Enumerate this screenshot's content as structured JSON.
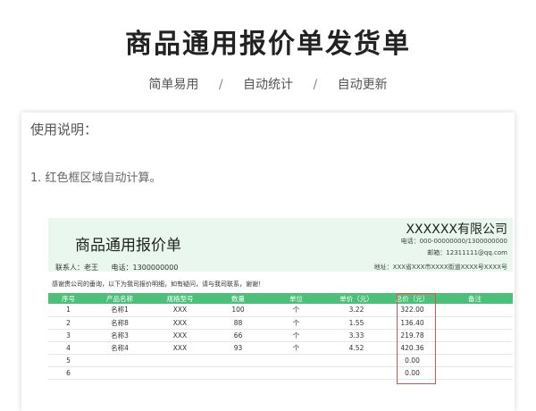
{
  "header": {
    "title": "商品通用报价单发货单",
    "features": [
      "简单易用",
      "自动统计",
      "自动更新"
    ],
    "separator": "/"
  },
  "usage": {
    "title": "使用说明：",
    "item1": "1. 红色框区域自动计算。"
  },
  "sheet": {
    "title": "商品通用报价单",
    "company": "XXXXXX有限公司",
    "phone": "电话：000-00000000/1300000000",
    "email": "邮箱：12311111@qq.com",
    "contact": "联系人：老王",
    "contact_phone": "电话：1300000000",
    "address": "地址：XXX省XXX市XXXX街道XXXX号XXXX号",
    "thanks": "感谢贵公司的垂询，以下为我司报价明细，如有疑问，请与我司联系，谢谢！",
    "columns": [
      "序号",
      "产品名称",
      "规格型号",
      "数量",
      "单位",
      "单价（元）",
      "总价（元）",
      "备注"
    ],
    "rows": [
      [
        "1",
        "名称1",
        "XXX",
        "100",
        "个",
        "3.22",
        "322.00",
        ""
      ],
      [
        "2",
        "名称8",
        "XXX",
        "88",
        "个",
        "1.55",
        "136.40",
        ""
      ],
      [
        "3",
        "名称3",
        "XXX",
        "66",
        "个",
        "3.33",
        "219.78",
        ""
      ],
      [
        "4",
        "名称4",
        "XXX",
        "93",
        "个",
        "4.52",
        "420.36",
        ""
      ],
      [
        "5",
        "",
        "",
        "",
        "",
        "",
        "0.00",
        ""
      ],
      [
        "6",
        "",
        "",
        "",
        "",
        "",
        "0.00",
        ""
      ]
    ],
    "accent_color": "#4cbf78",
    "highlight_color": "#d9534f"
  }
}
